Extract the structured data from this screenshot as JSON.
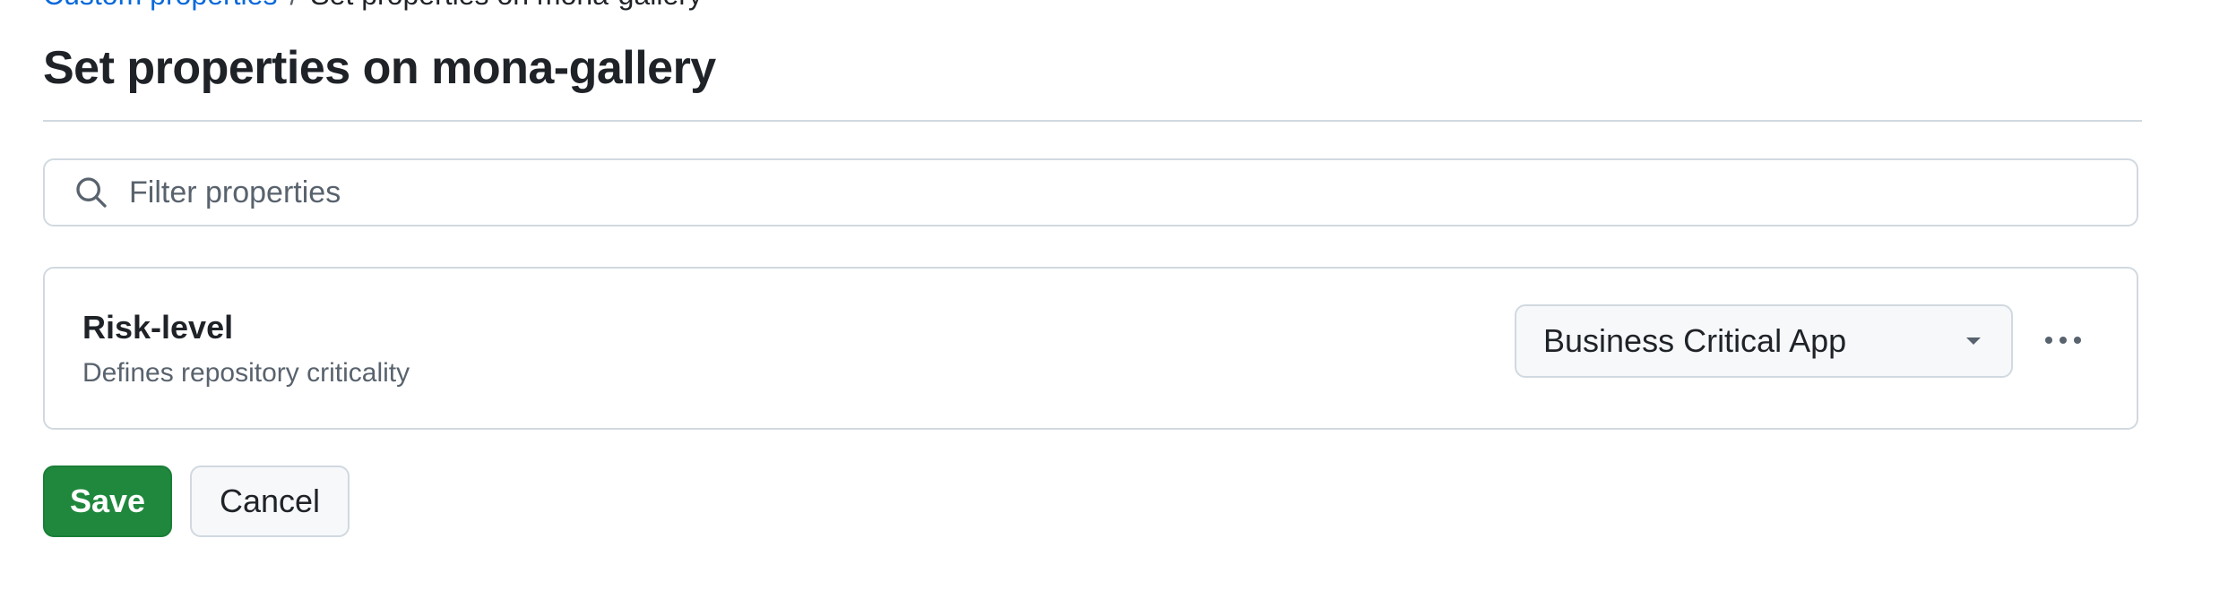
{
  "breadcrumb": {
    "parent": "Custom properties",
    "separator": "/",
    "current": "Set properties on mona-gallery"
  },
  "header": {
    "title": "Set properties on mona-gallery"
  },
  "search": {
    "placeholder": "Filter properties",
    "value": "",
    "icon": "search-icon"
  },
  "properties": [
    {
      "name": "Risk-level",
      "description": "Defines repository criticality",
      "selected_value": "Business Critical App",
      "select_icon": "triangle-down-icon",
      "menu_icon": "kebab-horizontal-icon"
    }
  ],
  "actions": {
    "save_label": "Save",
    "cancel_label": "Cancel"
  },
  "colors": {
    "link": "#0969da",
    "primary_button": "#1f883d",
    "border": "#d1d9e0",
    "muted_text": "#59636e",
    "text": "#1f2328"
  }
}
